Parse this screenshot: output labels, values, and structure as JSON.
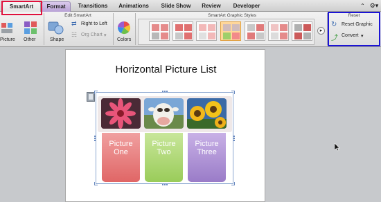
{
  "tabs": [
    {
      "label": "SmartArt"
    },
    {
      "label": "Format"
    },
    {
      "label": "Transitions"
    },
    {
      "label": "Animations"
    },
    {
      "label": "Slide Show"
    },
    {
      "label": "Review"
    },
    {
      "label": "Developer"
    }
  ],
  "ribbon": {
    "edit_smartart": {
      "title": "Edit SmartArt",
      "picture": "Picture",
      "other": "Other",
      "shape": "Shape",
      "right_to_left": "Right to Left",
      "org_chart": "Org Chart"
    },
    "colors": "Colors",
    "styles": {
      "title": "SmartArt Graphic Styles"
    },
    "reset": {
      "title": "Reset",
      "reset_graphic": "Reset Graphic",
      "convert": "Convert"
    }
  },
  "slide": {
    "title": "Horizontal Picture List",
    "items": [
      {
        "line1": "Picture",
        "line2": "One"
      },
      {
        "line1": "Picture",
        "line2": "Two"
      },
      {
        "line1": "Picture",
        "line2": "Three"
      }
    ]
  },
  "colors": {
    "highlight_red": "#e0103c",
    "highlight_blue": "#1c14d6",
    "card_red": "#e8706e",
    "card_green": "#a9d66a",
    "card_purple": "#a98ad0"
  }
}
